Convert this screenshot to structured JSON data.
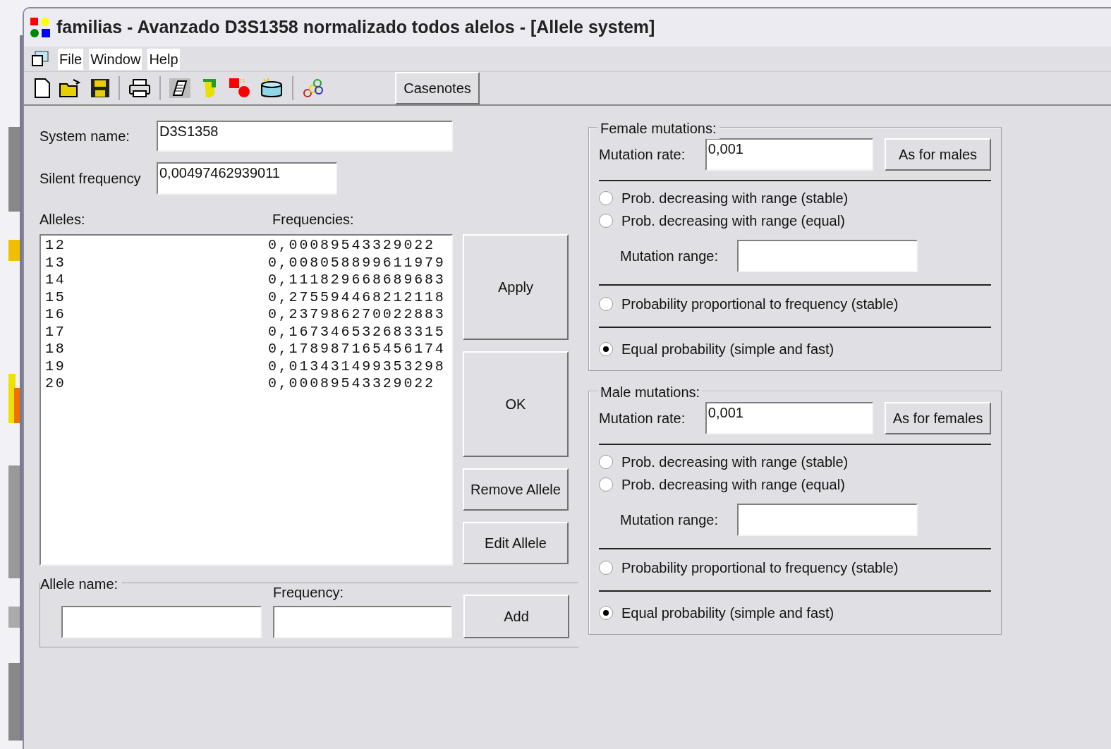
{
  "window": {
    "title": "familias - Avanzado D3S1358 normalizado todos alelos - [Allele system]"
  },
  "menu": [
    "File",
    "Window",
    "Help"
  ],
  "toolbar": {
    "casenotes": "Casenotes"
  },
  "system_name": {
    "label": "System name:",
    "value": "D3S1358"
  },
  "silent_frequency": {
    "label": "Silent frequency",
    "value": "0,00497462939011"
  },
  "alleles": {
    "label": "Alleles:",
    "freq_label": "Frequencies:",
    "rows": [
      {
        "allele": "12",
        "frequency": "0,00089543329022"
      },
      {
        "allele": "13",
        "frequency": "0,008058899611979"
      },
      {
        "allele": "14",
        "frequency": "0,111829668689683"
      },
      {
        "allele": "15",
        "frequency": "0,275594468212118"
      },
      {
        "allele": "16",
        "frequency": "0,237986270022883"
      },
      {
        "allele": "17",
        "frequency": "0,167346532683315"
      },
      {
        "allele": "18",
        "frequency": "0,178987165456174"
      },
      {
        "allele": "19",
        "frequency": "0,013431499353298"
      },
      {
        "allele": "20",
        "frequency": "0,00089543329022"
      }
    ]
  },
  "buttons": {
    "apply": "Apply",
    "ok": "OK",
    "remove": "Remove Allele",
    "edit": "Edit Allele",
    "add": "Add"
  },
  "new_allele": {
    "name_label": "Allele name:",
    "freq_label": "Frequency:"
  },
  "groups": [
    {
      "title": "Female mutations:",
      "rate_label": "Mutation rate:",
      "rate": "0,001",
      "copy_button": "As for males",
      "range_label": "Mutation range:",
      "options": [
        {
          "label": "Prob. decreasing with range (stable)",
          "selected": false
        },
        {
          "label": "Prob. decreasing with range (equal)",
          "selected": false
        },
        {
          "label": "Probability proportional to frequency (stable)",
          "selected": false
        },
        {
          "label": "Equal probability (simple and fast)",
          "selected": true
        }
      ]
    },
    {
      "title": "Male mutations:",
      "rate_label": "Mutation rate:",
      "rate": "0,001",
      "copy_button": "As for females",
      "range_label": "Mutation range:",
      "options": [
        {
          "label": "Prob. decreasing with range (stable)",
          "selected": false
        },
        {
          "label": "Prob. decreasing with range (equal)",
          "selected": false
        },
        {
          "label": "Probability proportional to frequency (stable)",
          "selected": false
        },
        {
          "label": "Equal probability (simple and fast)",
          "selected": true
        }
      ]
    }
  ]
}
